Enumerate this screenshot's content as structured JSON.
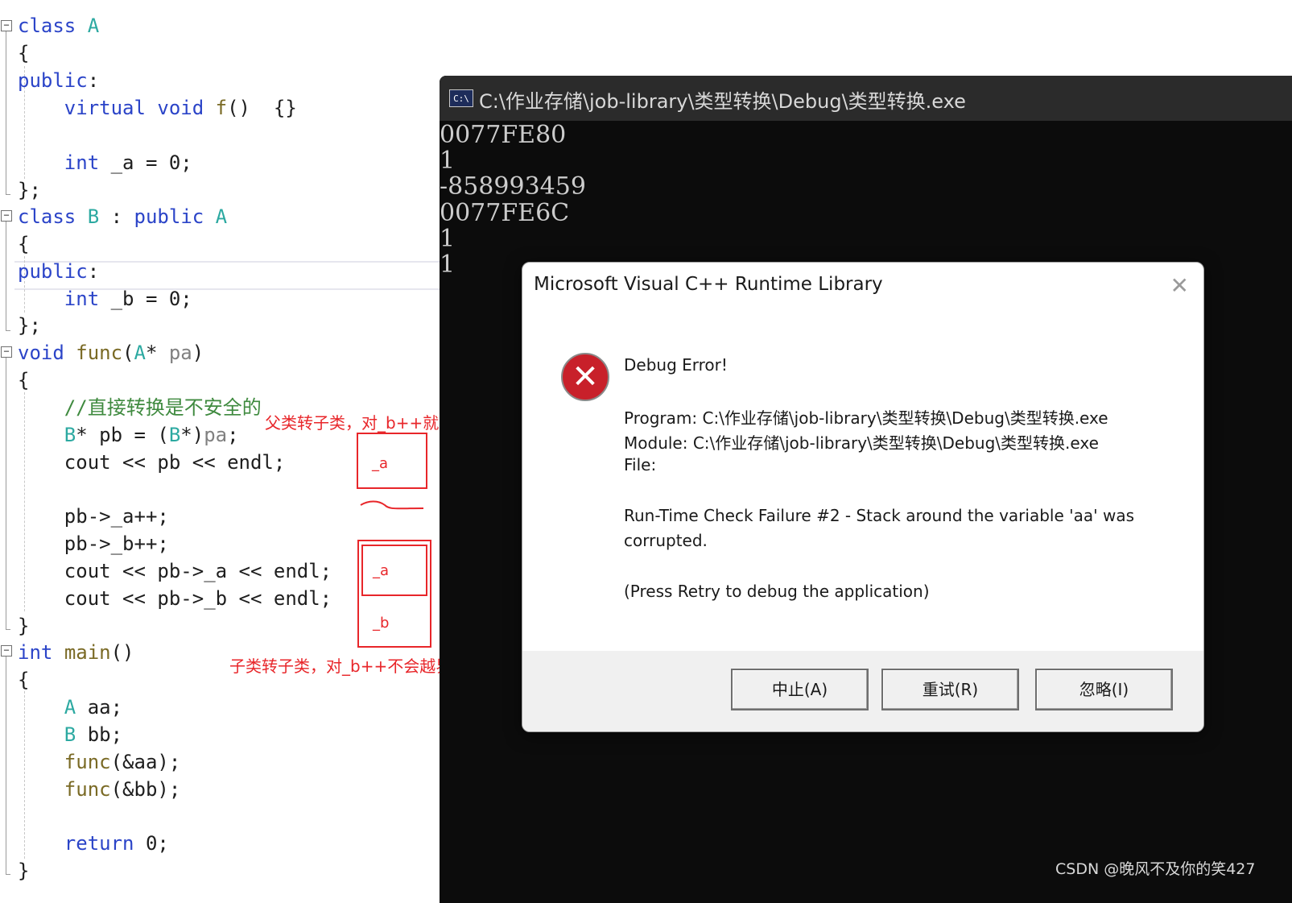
{
  "editor": {
    "lines": [
      [
        [
          "k",
          "class"
        ],
        [
          "p",
          " "
        ],
        [
          "ty",
          "A"
        ]
      ],
      [
        [
          "p",
          "{"
        ]
      ],
      [
        [
          "k",
          "public"
        ],
        [
          "p",
          ":"
        ]
      ],
      [
        [
          "p",
          "    "
        ],
        [
          "k",
          "virtual"
        ],
        [
          "p",
          " "
        ],
        [
          "k",
          "void"
        ],
        [
          "p",
          " "
        ],
        [
          "fn",
          "f"
        ],
        [
          "p",
          "()  {}"
        ]
      ],
      [
        [
          "p",
          ""
        ]
      ],
      [
        [
          "p",
          "    "
        ],
        [
          "k",
          "int"
        ],
        [
          "p",
          " _a = 0;"
        ]
      ],
      [
        [
          "p",
          "};"
        ]
      ],
      [
        [
          "k",
          "class"
        ],
        [
          "p",
          " "
        ],
        [
          "ty",
          "B"
        ],
        [
          "p",
          " : "
        ],
        [
          "k",
          "public"
        ],
        [
          "p",
          " "
        ],
        [
          "ty",
          "A"
        ]
      ],
      [
        [
          "p",
          "{"
        ]
      ],
      [
        [
          "k",
          "public"
        ],
        [
          "p",
          ":"
        ]
      ],
      [
        [
          "p",
          "    "
        ],
        [
          "k",
          "int"
        ],
        [
          "p",
          " _b = 0;"
        ]
      ],
      [
        [
          "p",
          "};"
        ]
      ],
      [
        [
          "k",
          "void"
        ],
        [
          "p",
          " "
        ],
        [
          "fn",
          "func"
        ],
        [
          "p",
          "("
        ],
        [
          "ty",
          "A"
        ],
        [
          "p",
          "* "
        ],
        [
          "pr",
          "pa"
        ],
        [
          "p",
          ")"
        ]
      ],
      [
        [
          "p",
          "{"
        ]
      ],
      [
        [
          "p",
          "    "
        ],
        [
          "cm",
          "//直接转换是不安全的"
        ]
      ],
      [
        [
          "p",
          "    "
        ],
        [
          "ty",
          "B"
        ],
        [
          "p",
          "* pb = ("
        ],
        [
          "ty",
          "B"
        ],
        [
          "p",
          "*)"
        ],
        [
          "pr",
          "pa"
        ],
        [
          "p",
          ";"
        ]
      ],
      [
        [
          "p",
          "    cout << pb << endl;"
        ]
      ],
      [
        [
          "p",
          ""
        ]
      ],
      [
        [
          "p",
          "    pb->_a++;"
        ]
      ],
      [
        [
          "p",
          "    pb->_b++;"
        ]
      ],
      [
        [
          "p",
          "    cout << pb->_a << endl;"
        ]
      ],
      [
        [
          "p",
          "    cout << pb->_b << endl;"
        ]
      ],
      [
        [
          "p",
          "}"
        ]
      ],
      [
        [
          "k",
          "int"
        ],
        [
          "p",
          " "
        ],
        [
          "fn",
          "main"
        ],
        [
          "p",
          "()"
        ]
      ],
      [
        [
          "p",
          "{"
        ]
      ],
      [
        [
          "p",
          "    "
        ],
        [
          "ty",
          "A"
        ],
        [
          "p",
          " aa;"
        ]
      ],
      [
        [
          "p",
          "    "
        ],
        [
          "ty",
          "B"
        ],
        [
          "p",
          " bb;"
        ]
      ],
      [
        [
          "p",
          "    "
        ],
        [
          "fn",
          "func"
        ],
        [
          "p",
          "(&aa);"
        ]
      ],
      [
        [
          "p",
          "    "
        ],
        [
          "fn",
          "func"
        ],
        [
          "p",
          "(&bb);"
        ]
      ],
      [
        [
          "p",
          ""
        ]
      ],
      [
        [
          "p",
          "    "
        ],
        [
          "k",
          "return"
        ],
        [
          "p",
          " 0;"
        ]
      ],
      [
        [
          "p",
          "}"
        ]
      ]
    ],
    "fold_collapse_glyph": "−"
  },
  "annotations": {
    "note_parent_to_child": "父类转子类，对_b++就会越界",
    "note_child_to_child": "子类转子类，对_b++不会越界",
    "box_a_label": "_a",
    "box2_a_label": "_a",
    "box2_b_label": "_b"
  },
  "console": {
    "title": "C:\\作业存储\\job-library\\类型转换\\Debug\\类型转换.exe",
    "icon_text": "C:\\",
    "output": [
      "0077FE80",
      "1",
      "-858993459",
      "0077FE6C",
      "1",
      "1"
    ]
  },
  "dialog": {
    "title": "Microsoft Visual C++ Runtime Library",
    "close_glyph": "✕",
    "icon_glyph": "✕",
    "heading": "Debug Error!",
    "program": "Program: C:\\作业存储\\job-library\\类型转换\\Debug\\类型转换.exe",
    "module": "Module: C:\\作业存储\\job-library\\类型转换\\Debug\\类型转换.exe",
    "file": "File:",
    "failure_line1": "Run-Time Check Failure #2 - Stack around the variable 'aa' was",
    "failure_line2": "corrupted.",
    "hint": "(Press Retry to debug the application)",
    "buttons": {
      "abort": "中止(A)",
      "retry": "重试(R)",
      "ignore": "忽略(I)"
    }
  },
  "watermark": "CSDN @晚风不及你的笑427"
}
